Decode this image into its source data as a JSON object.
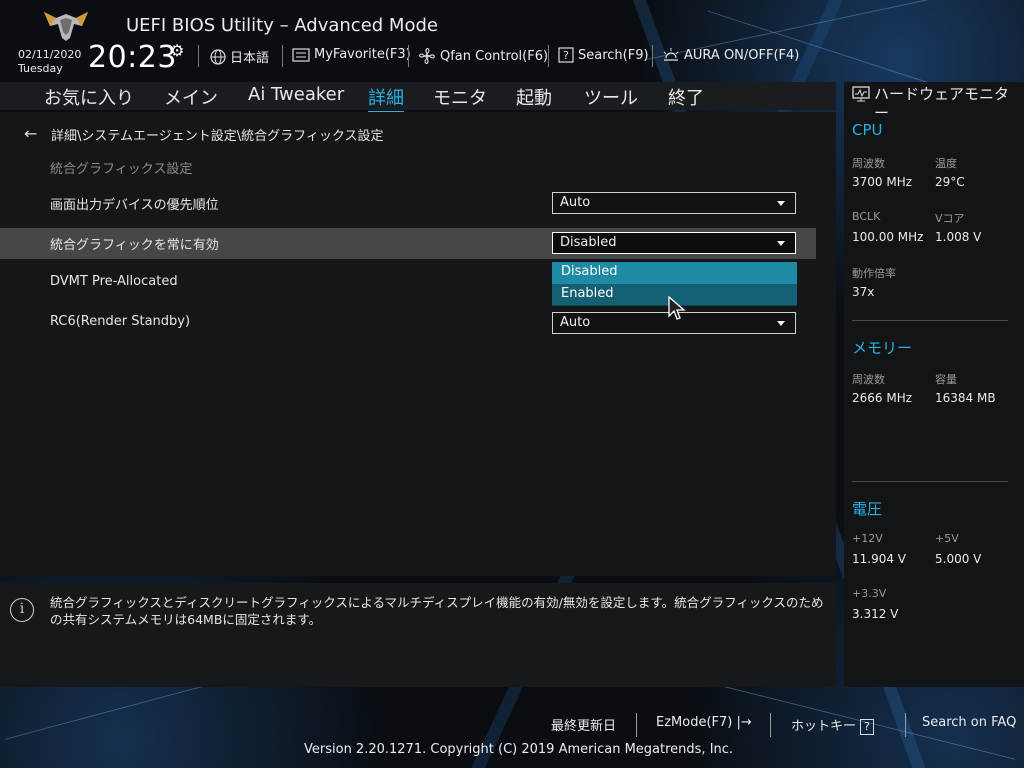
{
  "header": {
    "title": "UEFI BIOS Utility – Advanced Mode",
    "date": "02/11/2020",
    "day": "Tuesday",
    "time": "20:23",
    "items": [
      {
        "label": "日本語",
        "icon": "globe-icon"
      },
      {
        "label": "MyFavorite(F3)",
        "icon": "favorite-list-icon"
      },
      {
        "label": "Qfan Control(F6)",
        "icon": "fan-icon"
      },
      {
        "label": "Search(F9)",
        "icon": "search-help-icon"
      },
      {
        "label": "AURA ON/OFF(F4)",
        "icon": "aura-light-icon"
      }
    ]
  },
  "nav": {
    "tabs": [
      "お気に入り",
      "メイン",
      "Ai Tweaker",
      "詳細",
      "モニタ",
      "起動",
      "ツール",
      "終了"
    ],
    "active": "詳細"
  },
  "main": {
    "breadcrumb": "詳細\\システムエージェント設定\\統合グラフィックス設定",
    "section_title": "統合グラフィックス設定",
    "settings": [
      {
        "label": "画面出力デバイスの優先順位",
        "value": "Auto"
      },
      {
        "label": "統合グラフィックを常に有効",
        "value": "Disabled"
      },
      {
        "label": "DVMT Pre-Allocated",
        "value": ""
      },
      {
        "label": "RC6(Render Standby)",
        "value": "Auto"
      }
    ],
    "dropdown_options": [
      "Disabled",
      "Enabled"
    ]
  },
  "info": {
    "text": "統合グラフィックスとディスクリートグラフィックスによるマルチディスプレイ機能の有効/無効を設定します。統合グラフィックスのための共有システムメモリは64MBに固定されます。"
  },
  "hw_monitor": {
    "title": "ハードウェアモニター",
    "cpu": {
      "title": "CPU",
      "freq_label": "周波数",
      "freq": "3700 MHz",
      "temp_label": "温度",
      "temp": "29°C",
      "bclk_label": "BCLK",
      "bclk": "100.00 MHz",
      "vcore_label": "Vコア",
      "vcore": "1.008 V",
      "ratio_label": "動作倍率",
      "ratio": "37x"
    },
    "memory": {
      "title": "メモリー",
      "freq_label": "周波数",
      "freq": "2666 MHz",
      "cap_label": "容量",
      "cap": "16384 MB"
    },
    "voltage": {
      "title": "電圧",
      "v12_label": "+12V",
      "v12": "11.904 V",
      "v5_label": "+5V",
      "v5": "5.000 V",
      "v33_label": "+3.3V",
      "v33": "3.312 V"
    }
  },
  "footer": {
    "last_modified": "最終更新日",
    "ezmode": "EzMode(F7)",
    "hotkeys": "ホットキー",
    "hotkey_key": "?",
    "faq": "Search on FAQ",
    "version": "Version 2.20.1271. Copyright (C) 2019 American Megatrends, Inc."
  },
  "colors": {
    "accent": "#2bb0e6",
    "dropdown_selected": "#1e8aa3",
    "dropdown_hover": "#135f73"
  }
}
